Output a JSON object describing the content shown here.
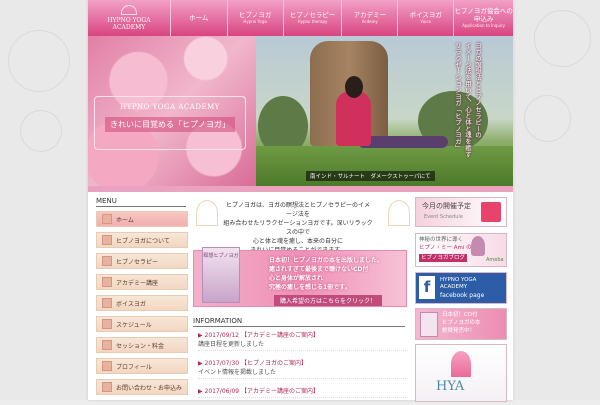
{
  "colors": {
    "nav_top": "#f2a1c6",
    "nav_bottom": "#d9447f",
    "accent": "#b22a55",
    "menu_bg": "#f2d7c2"
  },
  "logo": {
    "line1": "HYPNO YOGA",
    "line2": "ACADEMY"
  },
  "nav": {
    "items": [
      {
        "jp": "ホーム",
        "en": ""
      },
      {
        "jp": "ヒプノヨガ",
        "en": "Hypno Yoga"
      },
      {
        "jp": "ヒプノセラピー",
        "en": "Hypno therapy"
      },
      {
        "jp": "アカデミー",
        "en": "Acdemy"
      },
      {
        "jp": "ボイスヨガ",
        "en": "Voice"
      },
      {
        "jp": "ヒプノヨガ協会への申込み",
        "en": "Application to Inquiry"
      }
    ]
  },
  "hero": {
    "title": "HYPNO YOGA ACADEMY",
    "subtitle": "きれいに目覚める「ヒプノヨガ」",
    "vertical_col1": "ヨガの瞑想法とヒプノセラピーの",
    "vertical_col2": "イメージ法を用いて、心と体と魂を癒す",
    "vertical_col3": "リラクゼーションヨガ「ヒプノヨガ」",
    "caption": "南インド・サルナート　ダメークストゥーパにて"
  },
  "sidebar": {
    "heading": "MENU",
    "items": [
      {
        "label": "ホーム"
      },
      {
        "label": "ヒプノヨガについて"
      },
      {
        "label": "ヒプノセラピー"
      },
      {
        "label": "アカデミー講座"
      },
      {
        "label": "ボイスヨガ"
      },
      {
        "label": "スケジュール"
      },
      {
        "label": "セッション・料金"
      },
      {
        "label": "プロフィール"
      },
      {
        "label": "お問い合わせ・お申込み"
      }
    ]
  },
  "intro": {
    "line1": "ヒプノヨガは、ヨガの瞑想法とヒプノセラピーのイメージ法を",
    "line2": "組み合わせたリラクゼーションヨガです。深いリラックスの中で",
    "line3": "心と体と魂を癒し、本来の自分に",
    "line4": "きれいに目覚めることができます。"
  },
  "promo": {
    "book_title": "瞑想ヒプノヨガ",
    "line1": "日本初！ヒプノヨガの本を出版しました。",
    "line2": "癒されすぎて最後まで聴けないCD付",
    "line3": "心と身体が解放され",
    "line4": "究極の癒しを感じる1冊です。",
    "cta": "購入希望の方はこちらをクリック！"
  },
  "info": {
    "heading": "INFORMATION",
    "items": [
      {
        "date": "▶ 2017/09/12 【アカデミー講座のご案内】",
        "body": "講座日程を更新しました"
      },
      {
        "date": "▶ 2017/07/30 【ヒプノヨガのご案内】",
        "body": "イベント情報を掲載しました"
      },
      {
        "date": "▶ 2017/06/09 【アカデミー講座のご案内】",
        "body": ""
      }
    ]
  },
  "right": {
    "b1_title": "今月の開催予定",
    "b1_sub": "Event Schedule",
    "b2_line1": "神秘の世界に導く",
    "b2_line2": "ヒプノ・ミー Ami の",
    "b2_line3": "ヒプノヨガブログ",
    "b2_brand": "Ameba",
    "b3_title": "HYPNO YOGA",
    "b3_sub": "ACADEMY",
    "b3_fb": "facebook page",
    "b4_line1": "日本初！CD付",
    "b4_line2": "ヒプノヨガの本",
    "b4_line3": "絶賛発売中！",
    "b5_logo": "HYA"
  }
}
